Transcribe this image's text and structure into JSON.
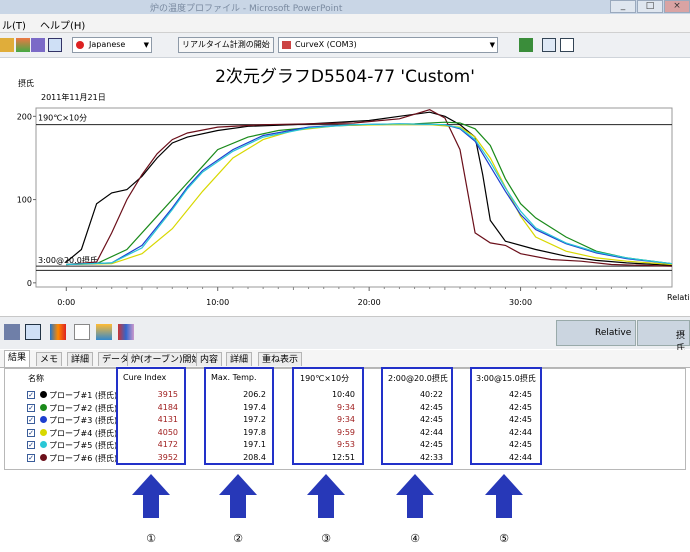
{
  "window": {
    "title": "炉の温度プロファイル - Microsoft PowerPoint"
  },
  "menubar": {
    "items": [
      "ル(T)",
      "ヘルプ(H)"
    ]
  },
  "toolbar": {
    "language": "Japanese",
    "realtime_button": "リアルタイム計測の開始",
    "port": "CurveX (COM3)"
  },
  "chart": {
    "title": "2次元グラフD5504-77 'Custom'",
    "date": "2011年11月21日",
    "ylabel": "摂氏",
    "xlabel": "Relative",
    "y_ticks": [
      "200",
      "100",
      "0"
    ],
    "x_ticks": [
      "0:00",
      "10:00",
      "20:00",
      "30:00"
    ],
    "annotation_top": "190℃×10分",
    "annotation_bottom": "3:00@20.0摂氏"
  },
  "chart_data": {
    "type": "line",
    "xlabel": "Relative",
    "ylabel": "摂氏",
    "x_unit": "minutes",
    "xlim": [
      -2,
      40
    ],
    "ylim": [
      -5,
      210
    ],
    "reference_lines": [
      190,
      20,
      15
    ],
    "series": [
      {
        "color": "#000000",
        "points": [
          [
            0,
            25
          ],
          [
            1,
            40
          ],
          [
            2,
            95
          ],
          [
            3,
            108
          ],
          [
            4,
            112
          ],
          [
            5,
            128
          ],
          [
            6,
            150
          ],
          [
            7,
            168
          ],
          [
            8,
            175
          ],
          [
            10,
            183
          ],
          [
            12,
            188
          ],
          [
            15,
            190
          ],
          [
            18,
            193
          ],
          [
            20,
            195
          ],
          [
            22,
            200
          ],
          [
            24,
            205
          ],
          [
            25,
            200
          ],
          [
            26,
            190
          ],
          [
            27,
            175
          ],
          [
            27.5,
            130
          ],
          [
            28,
            75
          ],
          [
            29,
            50
          ],
          [
            31,
            40
          ],
          [
            33,
            32
          ],
          [
            35,
            27
          ],
          [
            37,
            24
          ],
          [
            40,
            21
          ]
        ]
      },
      {
        "color": "#6b0f1a",
        "points": [
          [
            0,
            22
          ],
          [
            2,
            25
          ],
          [
            3,
            60
          ],
          [
            4,
            100
          ],
          [
            5,
            130
          ],
          [
            6,
            155
          ],
          [
            7,
            172
          ],
          [
            8,
            180
          ],
          [
            10,
            187
          ],
          [
            13,
            190
          ],
          [
            16,
            191
          ],
          [
            19,
            192
          ],
          [
            22,
            197
          ],
          [
            24,
            208
          ],
          [
            25,
            198
          ],
          [
            26,
            160
          ],
          [
            27,
            60
          ],
          [
            28,
            48
          ],
          [
            29,
            45
          ],
          [
            30,
            35
          ],
          [
            32,
            28
          ],
          [
            34,
            26
          ],
          [
            36,
            22
          ],
          [
            40,
            20
          ]
        ]
      },
      {
        "color": "#1a8a1a",
        "points": [
          [
            0,
            22
          ],
          [
            2,
            23
          ],
          [
            4,
            40
          ],
          [
            6,
            80
          ],
          [
            8,
            120
          ],
          [
            9,
            140
          ],
          [
            10,
            160
          ],
          [
            12,
            175
          ],
          [
            14,
            183
          ],
          [
            17,
            188
          ],
          [
            20,
            190
          ],
          [
            23,
            191
          ],
          [
            25,
            193
          ],
          [
            26,
            192
          ],
          [
            27,
            185
          ],
          [
            28,
            165
          ],
          [
            29,
            125
          ],
          [
            30,
            95
          ],
          [
            31,
            78
          ],
          [
            33,
            55
          ],
          [
            35,
            38
          ],
          [
            37,
            30
          ],
          [
            40,
            23
          ]
        ]
      },
      {
        "color": "#d8d800",
        "points": [
          [
            0,
            22
          ],
          [
            3,
            23
          ],
          [
            5,
            35
          ],
          [
            7,
            65
          ],
          [
            9,
            110
          ],
          [
            11,
            150
          ],
          [
            13,
            172
          ],
          [
            15,
            183
          ],
          [
            18,
            189
          ],
          [
            21,
            190
          ],
          [
            24,
            190
          ],
          [
            26,
            187
          ],
          [
            27,
            175
          ],
          [
            28,
            150
          ],
          [
            29,
            115
          ],
          [
            30,
            80
          ],
          [
            31,
            55
          ],
          [
            33,
            38
          ],
          [
            35,
            30
          ],
          [
            37,
            26
          ],
          [
            40,
            22
          ]
        ]
      },
      {
        "color": "#1d3fcf",
        "points": [
          [
            0,
            22
          ],
          [
            3,
            24
          ],
          [
            5,
            45
          ],
          [
            7,
            90
          ],
          [
            8,
            115
          ],
          [
            9,
            135
          ],
          [
            11,
            160
          ],
          [
            13,
            177
          ],
          [
            16,
            187
          ],
          [
            19,
            190
          ],
          [
            22,
            191
          ],
          [
            25,
            190
          ],
          [
            26,
            185
          ],
          [
            27,
            170
          ],
          [
            28,
            140
          ],
          [
            29,
            110
          ],
          [
            30,
            82
          ],
          [
            31,
            64
          ],
          [
            33,
            47
          ],
          [
            35,
            36
          ],
          [
            37,
            29
          ],
          [
            40,
            23
          ]
        ]
      },
      {
        "color": "#2ac7d6",
        "points": [
          [
            0,
            22
          ],
          [
            3,
            24
          ],
          [
            5,
            42
          ],
          [
            7,
            88
          ],
          [
            8,
            113
          ],
          [
            9,
            133
          ],
          [
            11,
            158
          ],
          [
            13,
            175
          ],
          [
            16,
            186
          ],
          [
            19,
            190
          ],
          [
            22,
            191
          ],
          [
            25,
            190
          ],
          [
            26,
            186
          ],
          [
            27,
            172
          ],
          [
            28,
            145
          ],
          [
            29,
            114
          ],
          [
            30,
            86
          ],
          [
            31,
            66
          ],
          [
            33,
            48
          ],
          [
            35,
            37
          ],
          [
            37,
            30
          ],
          [
            40,
            23
          ]
        ]
      }
    ]
  },
  "lower_toolbar": {
    "relative_label": "Relative",
    "unit_label": "摂氏"
  },
  "tabs": [
    "結果",
    "メモ",
    "詳細",
    "データ",
    "炉(オーブン)開始",
    "内容",
    "詳細",
    "重ね表示"
  ],
  "table": {
    "name_header": "名称",
    "columns": [
      "Cure Index",
      "Max. Temp.",
      "190℃×10分",
      "2:00@20.0摂氏",
      "3:00@15.0摂氏"
    ],
    "rows": [
      {
        "name": "プローブ#1 (摂氏)",
        "color": "#000000",
        "cure": "3915",
        "max": "206.2",
        "c190": "10:40",
        "c200": "40:22",
        "c300": "42:45"
      },
      {
        "name": "プローブ#2 (摂氏)",
        "color": "#1a8a1a",
        "cure": "4184",
        "max": "197.4",
        "c190": "9:34",
        "c200": "42:45",
        "c300": "42:45"
      },
      {
        "name": "プローブ#3 (摂氏)",
        "color": "#1d3fcf",
        "cure": "4131",
        "max": "197.2",
        "c190": "9:34",
        "c200": "42:45",
        "c300": "42:45"
      },
      {
        "name": "プローブ#4 (摂氏)",
        "color": "#d8d800",
        "cure": "4050",
        "max": "197.8",
        "c190": "9:59",
        "c200": "42:44",
        "c300": "42:44"
      },
      {
        "name": "プローブ#5 (摂氏)",
        "color": "#2ac7d6",
        "cure": "4172",
        "max": "197.1",
        "c190": "9:53",
        "c200": "42:45",
        "c300": "42:45"
      },
      {
        "name": "プローブ#6 (摂氏)",
        "color": "#6b0f1a",
        "cure": "3952",
        "max": "208.4",
        "c190": "12:51",
        "c200": "42:33",
        "c300": "42:44"
      }
    ]
  },
  "callouts": [
    "①",
    "②",
    "③",
    "④",
    "⑤"
  ],
  "colors": {
    "highlight": "#2231c9",
    "arrow": "#2738b8",
    "value_red": "#a02020"
  }
}
